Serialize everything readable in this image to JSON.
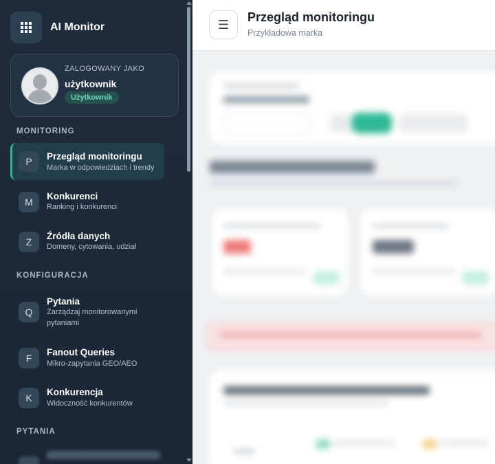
{
  "brand": {
    "title": "AI Monitor",
    "icon": "grid-icon"
  },
  "user": {
    "label": "ZALOGOWANY JAKO",
    "name": "użytkownik",
    "role": "Użytkownik"
  },
  "sections": {
    "monitoring": "MONITORING",
    "konfiguracja": "KONFIGURACJA",
    "pytania": "PYTANIA"
  },
  "nav": {
    "overview": {
      "letter": "P",
      "title": "Przegląd monitoringu",
      "sub": "Marka w odpowiedziach i trendy"
    },
    "competitors": {
      "letter": "M",
      "title": "Konkurenci",
      "sub": "Ranking i konkurenci"
    },
    "sources": {
      "letter": "Z",
      "title": "Źródła danych",
      "sub": "Domeny, cytowania, udział"
    },
    "questions": {
      "letter": "Q",
      "title": "Pytania",
      "sub": "Zarządzaj monitorowanymi pytaniami"
    },
    "fanout": {
      "letter": "F",
      "title": "Fanout Queries",
      "sub": "Mikro-zapytania GEO/AEO"
    },
    "competition": {
      "letter": "K",
      "title": "Konkurencja",
      "sub": "Widoczność konkurentów"
    }
  },
  "header": {
    "menu_icon": "☰",
    "title": "Przegląd monitoringu",
    "subtitle": "Przykładowa marka"
  },
  "colors": {
    "sidebar_bg": "#1d2b3a",
    "accent": "#2fb894",
    "badge_text": "#6ed6b6"
  }
}
